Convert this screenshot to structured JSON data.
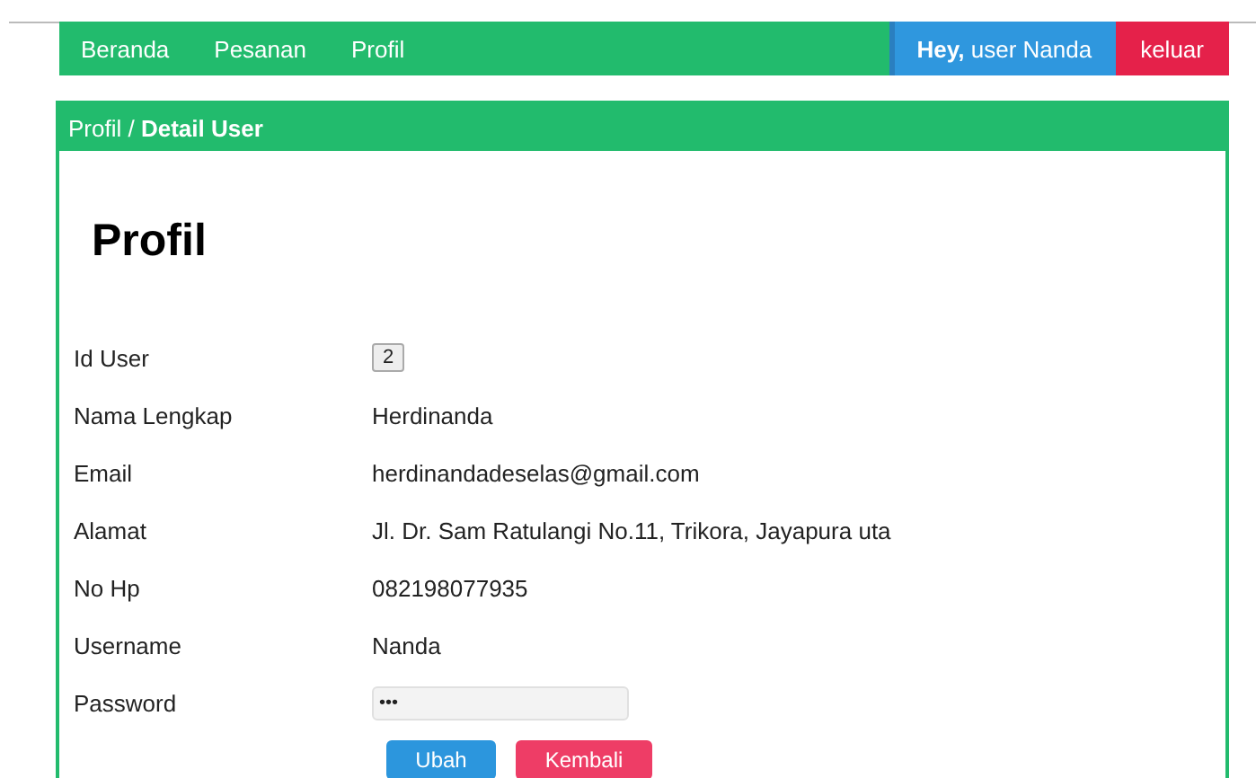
{
  "nav": {
    "links": [
      {
        "label": "Beranda"
      },
      {
        "label": "Pesanan"
      },
      {
        "label": "Profil"
      }
    ],
    "greeting": "**Hey,** user Nanda",
    "logout": "keluar"
  },
  "panel": {
    "breadcrumb": "Profil / **Detail User**",
    "heading": "Profil",
    "fields": [
      {
        "label": "Id User",
        "value": "2",
        "kind": "badge"
      },
      {
        "label": "Nama Lengkap",
        "value": "Herdinanda",
        "kind": "text"
      },
      {
        "label": "Email",
        "value": "herdinandadeselas@gmail.com",
        "kind": "text"
      },
      {
        "label": "Alamat",
        "value": "Jl. Dr. Sam Ratulangi No.11, Trikora, Jayapura uta",
        "kind": "text"
      },
      {
        "label": "No Hp",
        "value": "082198077935",
        "kind": "text"
      },
      {
        "label": "Username",
        "value": "Nanda",
        "kind": "text"
      },
      {
        "label": "Password",
        "value": "•••",
        "kind": "password"
      }
    ],
    "buttons": [
      {
        "label": "Ubah",
        "kind": "primary"
      },
      {
        "label": "Kembali",
        "kind": "danger"
      }
    ]
  }
}
